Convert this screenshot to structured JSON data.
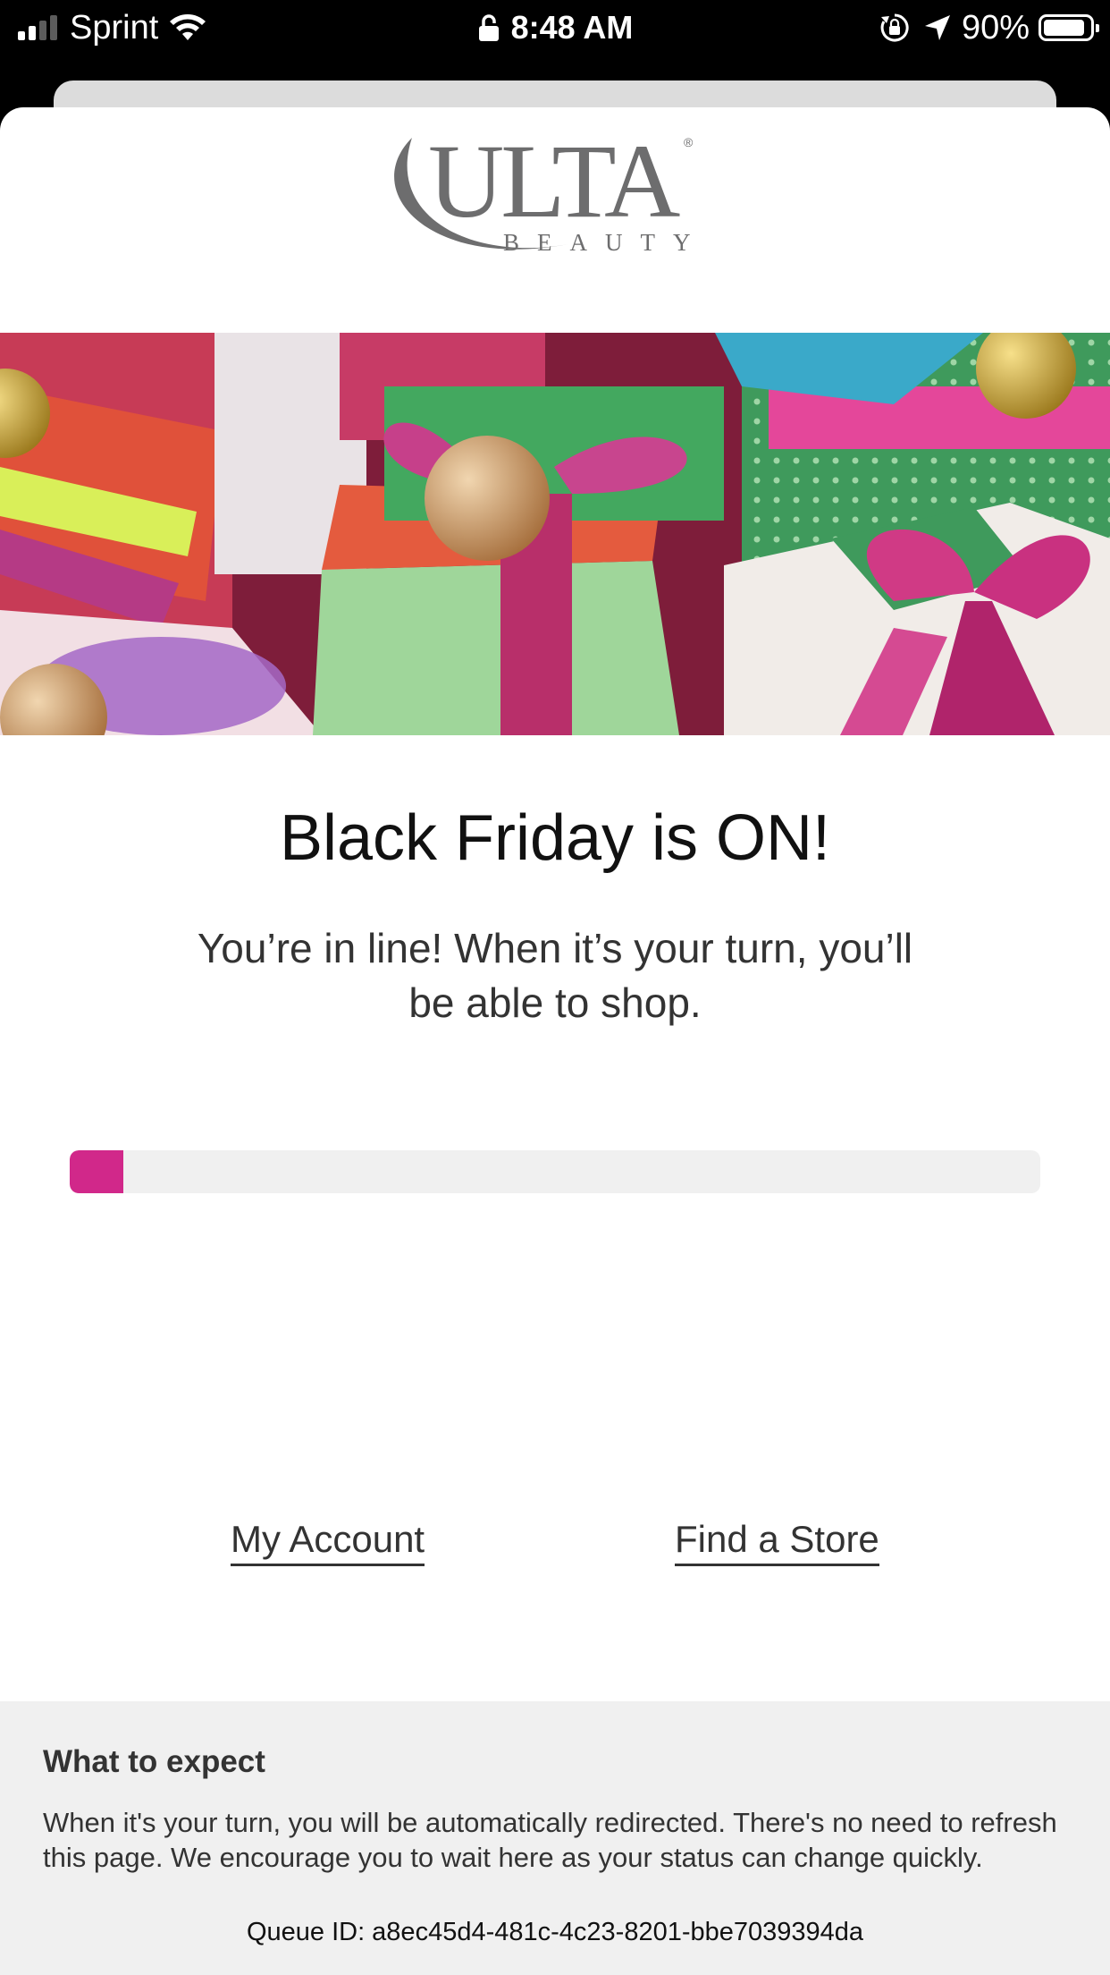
{
  "status_bar": {
    "carrier": "Sprint",
    "time": "8:48 AM",
    "battery_percent": "90%",
    "signal_bars_active": 2,
    "battery_level": 0.9
  },
  "brand": {
    "logo_main": "ULTA",
    "logo_sub": "BEAUTY",
    "logo_mark": "®"
  },
  "hero": {
    "image": "holiday gift boxes with ribbons and ornaments"
  },
  "main": {
    "headline": "Black Friday is ON!",
    "subtext": "You’re in line! When it’s your turn, you’ll be able to shop.",
    "progress": 0.055,
    "progress_color": "#d1288a"
  },
  "links": {
    "account": "My Account",
    "store": "Find a Store"
  },
  "info": {
    "title": "What to expect",
    "body": "When it's your turn, you will be automatically redirected. There's no need to refresh this page. We encourage you to wait here as your status can change quickly.",
    "queue_id": "Queue ID: a8ec45d4-481c-4c23-8201-bbe7039394da"
  },
  "icons": [
    "signal-icon",
    "wifi-icon",
    "lock-icon",
    "orientation-lock-icon",
    "location-arrow-icon",
    "battery-icon"
  ]
}
